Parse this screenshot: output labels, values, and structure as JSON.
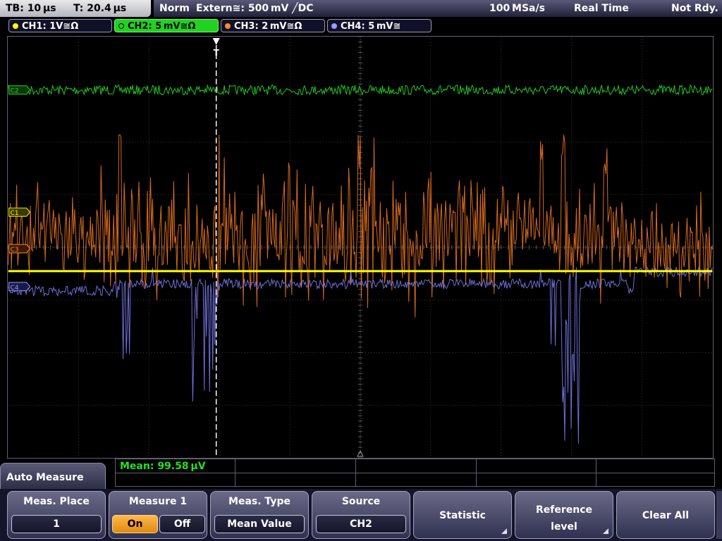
{
  "status": {
    "timebase": "TB: 10 µs",
    "trigger_time": "T: 20.4 µs",
    "mode": "Norm",
    "trigger_source": "Extern≅: 500 mV ╱DC",
    "sample_rate": "100 MSa/s",
    "acq_mode": "Real Time",
    "ready_state": "Not Rdy."
  },
  "channels": [
    {
      "label": "CH1: 1V≅Ω",
      "color": "#ffff00",
      "marker": "C1"
    },
    {
      "label": "CH2: 5 mV≅Ω",
      "color": "#22d222",
      "marker": "C2",
      "active": true
    },
    {
      "label": "CH3: 2 mV≅Ω",
      "color": "#ff8a2a",
      "marker": "C3"
    },
    {
      "label": "CH4: 5 mV≅",
      "color": "#9a9aff",
      "marker": "C4"
    }
  ],
  "measurement": {
    "result": "Mean: 99.58 µV"
  },
  "menu": {
    "title": "Auto Measure",
    "meas_place": {
      "label": "Meas. Place",
      "value": "1"
    },
    "measure": {
      "label": "Measure 1",
      "on": "On",
      "off": "Off"
    },
    "meas_type": {
      "label": "Meas. Type",
      "value": "Mean Value"
    },
    "source": {
      "label": "Source",
      "value": "CH2"
    },
    "statistic": {
      "label": "Statistic"
    },
    "reference_level": {
      "line1": "Reference",
      "line2": "level"
    },
    "clear_all": {
      "label": "Clear All"
    }
  },
  "colors": {
    "ch1": "#ffff00",
    "ch2": "#22d222",
    "ch3": "#e07020",
    "ch4": "#8080ff",
    "accent_on": "#f0a030",
    "panel": "#303050"
  }
}
